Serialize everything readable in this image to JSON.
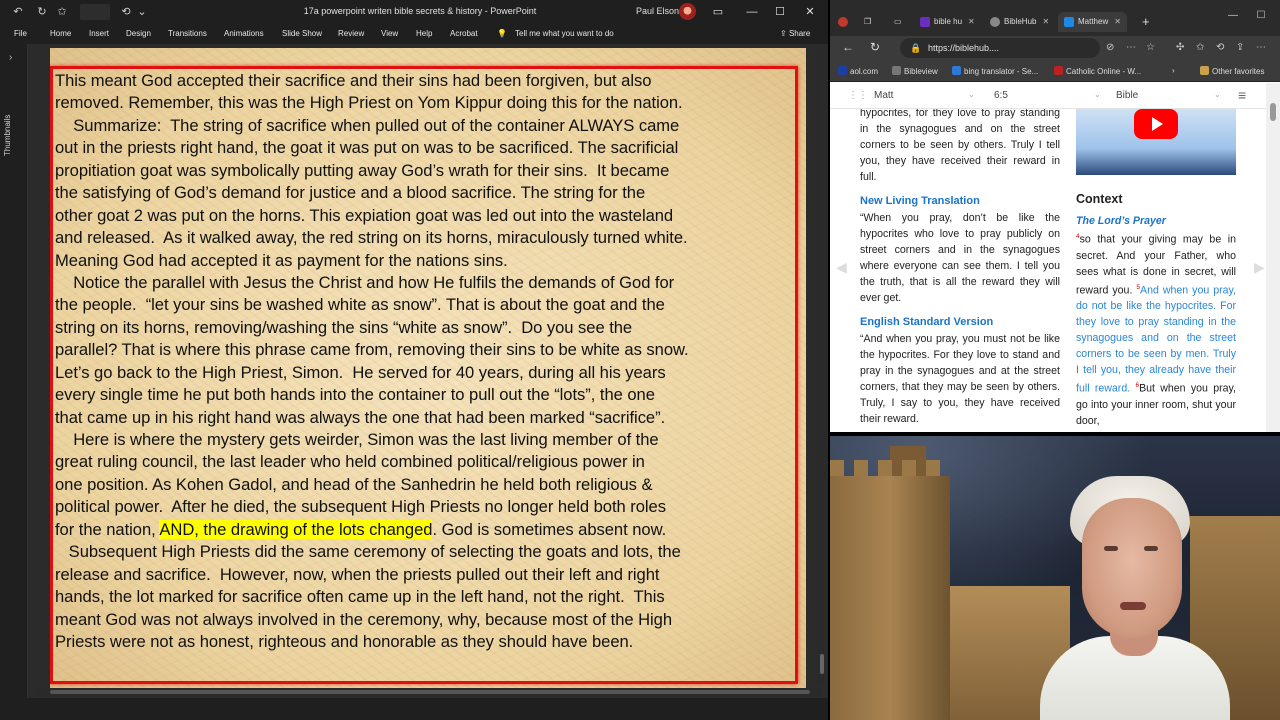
{
  "powerpoint": {
    "doc_title": "17a powerpoint writen bible secrets & history  -  PowerPoint",
    "user_name": "Paul Elson",
    "ribbon_tabs": [
      "File",
      "Home",
      "Insert",
      "Design",
      "Transitions",
      "Animations",
      "Slide Show",
      "Review",
      "View",
      "Help",
      "Acrobat",
      "Tell me what you want to do"
    ],
    "share_label": "Share",
    "thumbnails_label": "Thumbnails",
    "slide": {
      "lines": [
        "This meant God accepted their sacrifice and their sins had been forgiven, but also",
        "removed. Remember, this was the High Priest on Yom Kippur doing this for the nation.",
        "    Summarize:  The string of sacrifice when pulled out of the container ALWAYS came",
        "out in the priests right hand, the goat it was put on was to be sacrificed. The sacrificial",
        "propitiation goat was symbolically putting away God’s wrath for their sins.  It became",
        "the satisfying of God’s demand for justice and a blood sacrifice. The string for the",
        "other goat 2 was put on the horns. This expiation goat was led out into the wasteland",
        "and released.  As it walked away, the red string on its horns, miraculously turned white.",
        "Meaning God had accepted it as payment for the nations sins.",
        "    Notice the parallel with Jesus the Christ and how He fulfils the demands of God for",
        "the people.  “let your sins be washed white as snow”. That is about the goat and the",
        "string on its horns, removing/washing the sins “white as snow”.  Do you see the",
        "parallel? That is where this phrase came from, removing their sins to be white as snow.",
        "Let’s go back to the High Priest, Simon.  He served for 40 years, during all his years",
        "every single time he put both hands into the container to pull out the “lots”, the one",
        "that came up in his right hand was always the one that had been marked “sacrifice”.",
        "    Here is where the mystery gets weirder, Simon was the last living member of the",
        "great ruling council, the last leader who held combined political/religious power in",
        "one position. As Kohen Gadol, and head of the Sanhedrin he held both religious &",
        "political power.  After he died, the subsequent High Priests no longer held both roles",
        "for the nation, ",
        "   Subsequent High Priests did the same ceremony of selecting the goats and lots, the",
        "release and sacrifice.  However, now, when the priests pulled out their left and right",
        "hands, the lot marked for sacrifice often came up in the left hand, not the right.  This",
        "meant God was not always involved in the ceremony, why, because most of the High",
        "Priests were not as honest, righteous and honorable as they should have been."
      ],
      "highlight_text": "AND, the drawing of the lots changed",
      "highlight_after": ". God is sometimes absent now.",
      "highlight_color": "#ffff00",
      "border_color": "#e01010"
    }
  },
  "browser": {
    "tabs": [
      {
        "label": "bible hu",
        "active": false
      },
      {
        "label": "BibleHub",
        "active": false
      },
      {
        "label": "Matthew",
        "active": true
      }
    ],
    "new_tab": "+",
    "url": "https://biblehub....",
    "favorites": [
      "aol.com",
      "Bibleview",
      "bing translator - Se...",
      "Catholic Online - W...",
      "Other favorites"
    ],
    "toolbar": {
      "book": "Matt",
      "chapter": "6:5",
      "version": "Bible"
    },
    "left_column": {
      "top_text": "hypocrites, for they love to pray standing in the synagogues and on the street corners to be seen by others. Truly I tell you, they have received their reward in full.",
      "sections": [
        {
          "heading": "New Living Translation",
          "text": "“When you pray, don’t be like the hypocrites who love to pray publicly on street corners and in the synagogues where everyone can see them. I tell you the truth, that is all the reward they will ever get."
        },
        {
          "heading": "English Standard Version",
          "text": "“And when you pray, you must not be like the hypocrites. For they love to stand and pray in the synagogues and at the street corners, that they may be seen by others. Truly, I say to you, they have received their reward."
        }
      ]
    },
    "right_column": {
      "context_heading": "Context",
      "subheading": "The Lord’s Prayer",
      "verse4_num": "4",
      "verse4": "so that your giving may be in secret. And your Father, who sees what is done in secret, will reward you. ",
      "verse5_num": "5",
      "verse5": "And when you pray, do not be like the hypocrites. For they love to pray standing in the synagogues and on the street corners to be seen by men. Truly I tell you, they already have their full reward. ",
      "verse6_num": "6",
      "verse6": "But when you pray, go into your inner room, shut your door,",
      "verse5_color": "#2a86d8"
    }
  }
}
